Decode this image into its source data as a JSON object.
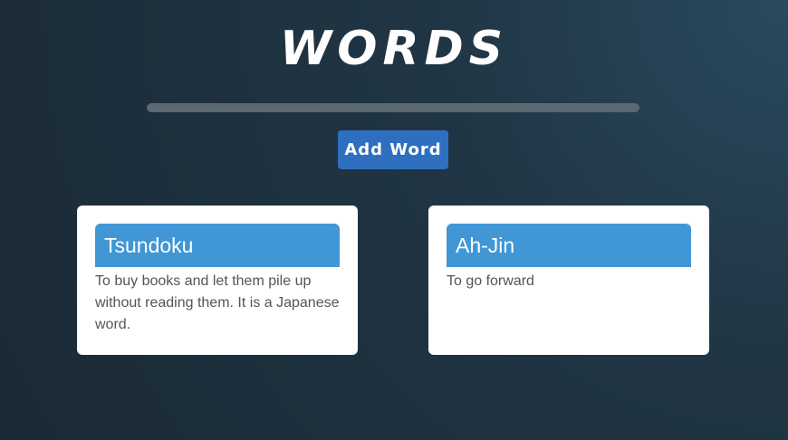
{
  "header": {
    "title": "WORDS"
  },
  "toolbar": {
    "add_label": "Add Word"
  },
  "cards": [
    {
      "word": "Tsundoku",
      "definition": "To buy books and let them pile up without reading them. It is a Japanese word."
    },
    {
      "word": "Ah-Jin",
      "definition": "To go forward"
    }
  ],
  "colors": {
    "accent_button": "#2f6fbf",
    "card_header": "#4196d6",
    "divider": "#5b6a72"
  }
}
